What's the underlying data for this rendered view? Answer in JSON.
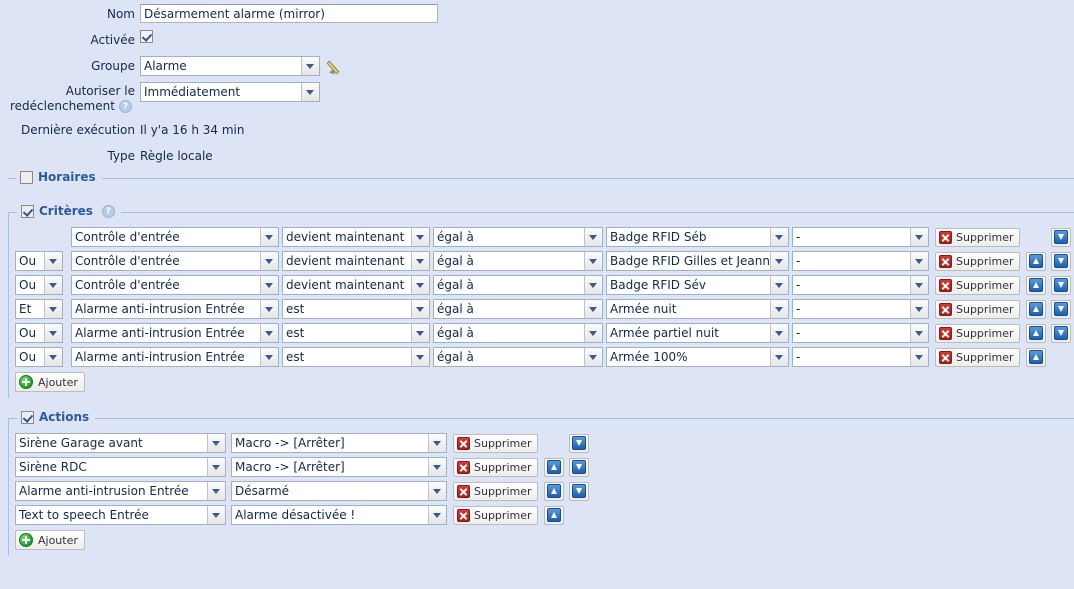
{
  "form": {
    "name": {
      "label": "Nom",
      "value": "Désarmement alarme (mirror)"
    },
    "enabled": {
      "label": "Activée",
      "checked": true
    },
    "group": {
      "label": "Groupe",
      "value": "Alarme",
      "edit_icon": "pencil-icon"
    },
    "retrigger": {
      "label_line1": "Autoriser le",
      "label_line2": "redéclenchement",
      "value": "Immédiatement",
      "help_icon": "help-icon"
    },
    "last_run": {
      "label": "Dernière exécution",
      "value": "Il y'a 16 h 34 min"
    },
    "type": {
      "label": "Type",
      "value": "Règle locale"
    }
  },
  "sections": {
    "schedules": {
      "title": "Horaires",
      "checked": false
    },
    "criteria": {
      "title": "Critères",
      "checked": true,
      "has_help": true
    },
    "actions": {
      "title": "Actions",
      "checked": true
    }
  },
  "criteria": {
    "rows": [
      {
        "operator": "",
        "device": "Contrôle d'entrée",
        "event": "devient maintenant",
        "comparator": "égal à",
        "value": "Badge RFID Séb",
        "extra": "-",
        "delete_label": "Supprimer",
        "has_up": false,
        "has_down": true
      },
      {
        "operator": "Ou",
        "device": "Contrôle d'entrée",
        "event": "devient maintenant",
        "comparator": "égal à",
        "value": "Badge RFID Gilles et Jeanne",
        "extra": "-",
        "delete_label": "Supprimer",
        "has_up": true,
        "has_down": true
      },
      {
        "operator": "Ou",
        "device": "Contrôle d'entrée",
        "event": "devient maintenant",
        "comparator": "égal à",
        "value": "Badge RFID Sév",
        "extra": "-",
        "delete_label": "Supprimer",
        "has_up": true,
        "has_down": true
      },
      {
        "operator": "Et",
        "device": "Alarme anti-intrusion Entrée",
        "event": "est",
        "comparator": "égal à",
        "value": "Armée nuit",
        "extra": "-",
        "delete_label": "Supprimer",
        "has_up": true,
        "has_down": true
      },
      {
        "operator": "Ou",
        "device": "Alarme anti-intrusion Entrée",
        "event": "est",
        "comparator": "égal à",
        "value": "Armée partiel nuit",
        "extra": "-",
        "delete_label": "Supprimer",
        "has_up": true,
        "has_down": true
      },
      {
        "operator": "Ou",
        "device": "Alarme anti-intrusion Entrée",
        "event": "est",
        "comparator": "égal à",
        "value": "Armée 100%",
        "extra": "-",
        "delete_label": "Supprimer",
        "has_up": true,
        "has_down": false
      }
    ],
    "add_label": "Ajouter"
  },
  "actions": {
    "rows": [
      {
        "device": "Sirène Garage avant",
        "command": "Macro -> [Arrêter]",
        "delete_label": "Supprimer",
        "has_up": false,
        "has_down": true
      },
      {
        "device": "Sirène RDC",
        "command": "Macro -> [Arrêter]",
        "delete_label": "Supprimer",
        "has_up": true,
        "has_down": true
      },
      {
        "device": "Alarme anti-intrusion Entrée",
        "command": "Désarmé",
        "delete_label": "Supprimer",
        "has_up": true,
        "has_down": true
      },
      {
        "device": "Text to speech Entrée",
        "command": "Alarme désactivée !",
        "delete_label": "Supprimer",
        "has_up": true,
        "has_down": false
      }
    ],
    "add_label": "Ajouter"
  },
  "colors": {
    "background": "#dde4f5",
    "border": "#a8c0e8",
    "legend_text": "#2c5aa0",
    "text": "#13294b",
    "delete_red": "#b5251f",
    "arrow_blue": "#1e5fae",
    "add_green": "#1f9a28"
  }
}
